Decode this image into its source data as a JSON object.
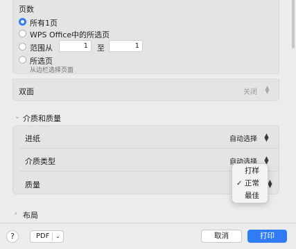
{
  "pages": {
    "title": "页数",
    "options": [
      {
        "label": "所有1页",
        "selected": true
      },
      {
        "label": "WPS Office中的所选页",
        "selected": false
      },
      {
        "label": "范围从",
        "selected": false
      },
      {
        "label": "所选页",
        "selected": false
      }
    ],
    "range_from": "1",
    "range_to_label": "至",
    "range_to": "1",
    "selection_hint": "从边栏选择页面"
  },
  "duplex": {
    "label": "双面",
    "value": "关闭"
  },
  "media_quality": {
    "title": "介质和质量",
    "rows": [
      {
        "label": "进纸",
        "value": "自动选择"
      },
      {
        "label": "介质类型",
        "value": "自动选择"
      },
      {
        "label": "质量",
        "value": ""
      }
    ]
  },
  "quality_menu": {
    "items": [
      "打样",
      "正常",
      "最佳"
    ],
    "checked": "正常"
  },
  "layout": {
    "title": "布局"
  },
  "footer": {
    "help": "?",
    "pdf": "PDF",
    "cancel": "取消",
    "print": "打印"
  },
  "colors": {
    "accent": "#2f7cf6"
  }
}
